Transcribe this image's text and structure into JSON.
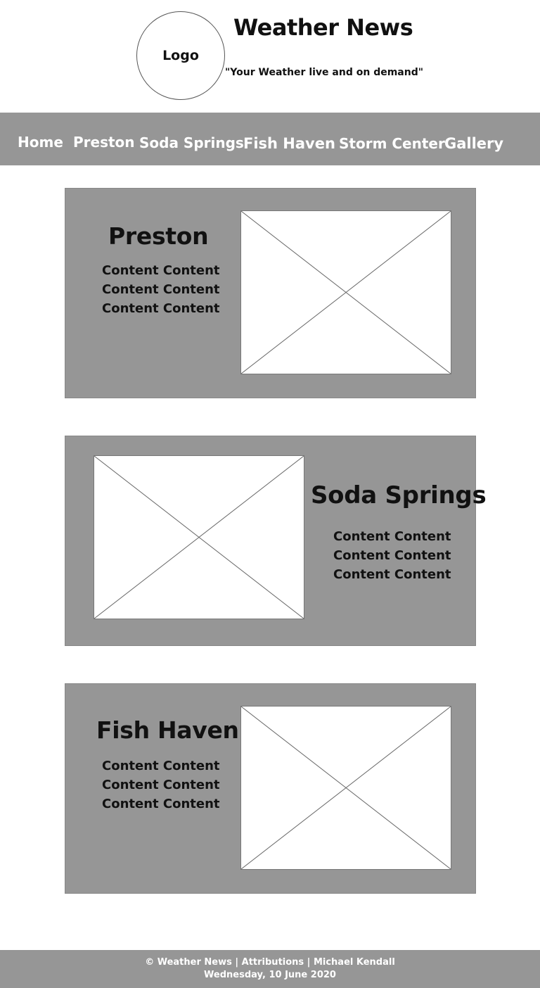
{
  "header": {
    "logo_label": "Logo",
    "title": "Weather News",
    "tagline": "\"Your Weather live and on demand\""
  },
  "nav": {
    "items": [
      {
        "label": "Home"
      },
      {
        "label": "Preston"
      },
      {
        "label": "Soda Springs"
      },
      {
        "label": "Fish Haven"
      },
      {
        "label": "Storm Center"
      },
      {
        "label": "Gallery"
      }
    ]
  },
  "cards": [
    {
      "title": "Preston",
      "lines": [
        "Content Content",
        "Content Content",
        "Content Content"
      ]
    },
    {
      "title": "Soda Springs",
      "lines": [
        "Content Content",
        "Content Content",
        "Content Content"
      ]
    },
    {
      "title": "Fish Haven",
      "lines": [
        "Content Content",
        "Content Content",
        "Content Content"
      ]
    }
  ],
  "footer": {
    "line1": "© Weather News | Attributions | Michael Kendall",
    "line2": "Wednesday, 10 June 2020"
  },
  "colors": {
    "nav_bg": "#969696",
    "card_bg": "#969696",
    "footer_bg": "#969696",
    "placeholder_bg": "#ffffff"
  }
}
